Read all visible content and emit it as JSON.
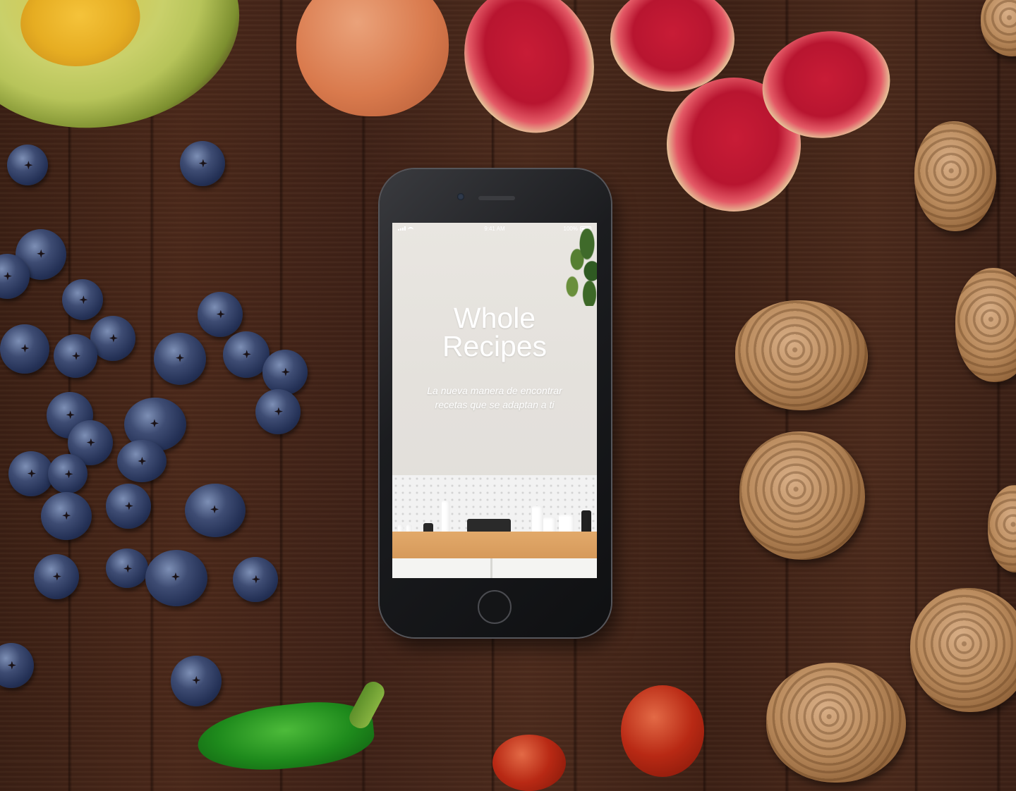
{
  "status_bar": {
    "time": "9:41 AM",
    "battery": "100%"
  },
  "app": {
    "title_line1": "Whole",
    "title_line2": "Recipes",
    "tagline_line1": "La nueva manera de encontrar",
    "tagline_line2": "recetas que se adaptan a ti"
  },
  "colors": {
    "text": "#ffffff",
    "screen_background": "#e4e1dc",
    "counter_wood": "#d69a5b",
    "phone_body": "#1b1c1f"
  },
  "icons": {
    "signal": "cellular-signal-icon",
    "wifi": "wifi-icon",
    "battery": "battery-icon"
  }
}
